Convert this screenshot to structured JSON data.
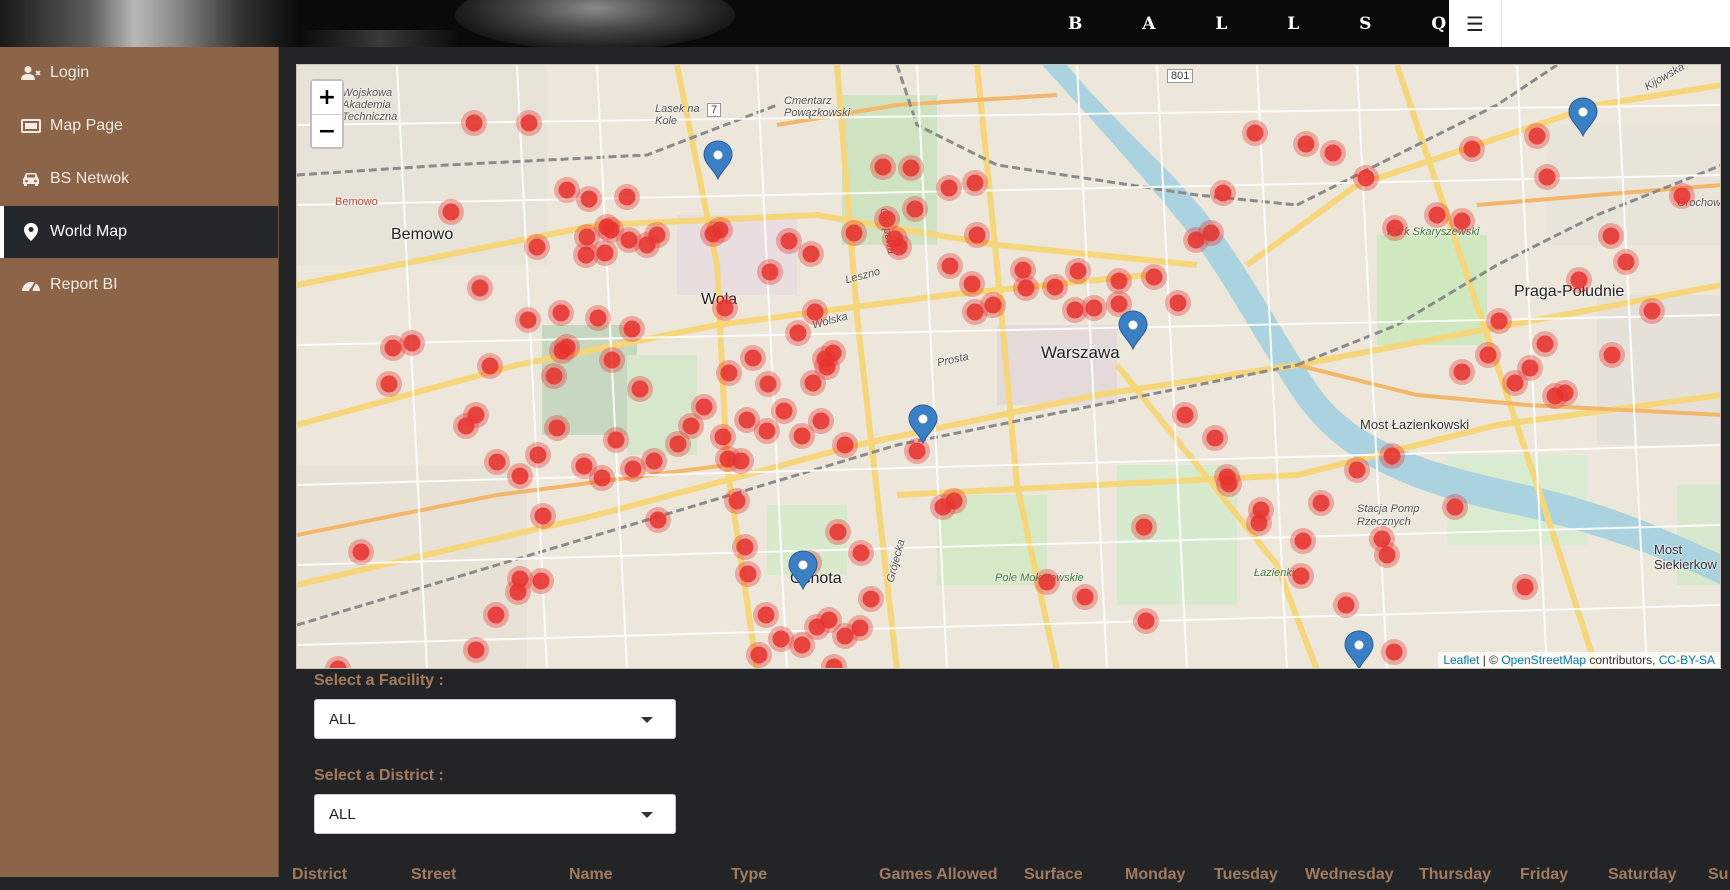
{
  "header": {
    "brand": "B A L L S Q U A D",
    "menu_icon": "hamburger-icon",
    "menu_glyph": "☰"
  },
  "sidebar": {
    "items": [
      {
        "label": "Login",
        "icon": "user-login-icon"
      },
      {
        "label": "Map Page",
        "icon": "map-page-icon"
      },
      {
        "label": "BS Netwok",
        "icon": "car-icon"
      },
      {
        "label": "World Map",
        "icon": "map-marker-icon",
        "active": true
      },
      {
        "label": "Report BI",
        "icon": "dashboard-icon"
      }
    ]
  },
  "map": {
    "zoom_in": "+",
    "zoom_out": "−",
    "labels": {
      "bemowo": "Bemowo",
      "bemowo_small": "Bemowo",
      "wola": "Wola",
      "warszawa": "Warszawa",
      "praga": "Praga-Południe",
      "ochota": "Ochota",
      "most": "Most Łazienkowski",
      "most_siek": "Most Siekierkow",
      "cmentarz": "Cmentarz Powązkowski",
      "lasek": "Lasek na Kole",
      "wojskowa": "Wojskowa Akademia Techniczna",
      "park": "Park Skaryszewski",
      "pole": "Pole Mokotowskie",
      "lazienki": "Łazienki",
      "stacja": "Stacja Pomp Rzecznych",
      "road_801": "801",
      "road_7": "7",
      "kijowska": "Kijowska",
      "grochowska": "Grochowsk",
      "okopowa": "Okopowa",
      "leszno": "Leszno",
      "wolska": "Wolska",
      "prosta": "Prosta",
      "grojecka": "Grójecka"
    },
    "attribution": {
      "leaflet": "Leaflet",
      "sep": " | © ",
      "osm": "OpenStreetMap",
      "contrib": " contributors, ",
      "license": "CC-BY-SA"
    },
    "marker_color": "#e8322e",
    "pin_color": "#3b7fc4"
  },
  "filters": {
    "facility_label": "Select a Facility :",
    "facility_value": "ALL",
    "district_label": "Select a District :",
    "district_value": "ALL"
  },
  "table": {
    "headers": [
      "District",
      "Street",
      "Name",
      "Type",
      "Games Allowed",
      "Surface",
      "Monday",
      "Tuesday",
      "Wednesday",
      "Thursday",
      "Friday",
      "Saturday",
      "Su"
    ]
  }
}
